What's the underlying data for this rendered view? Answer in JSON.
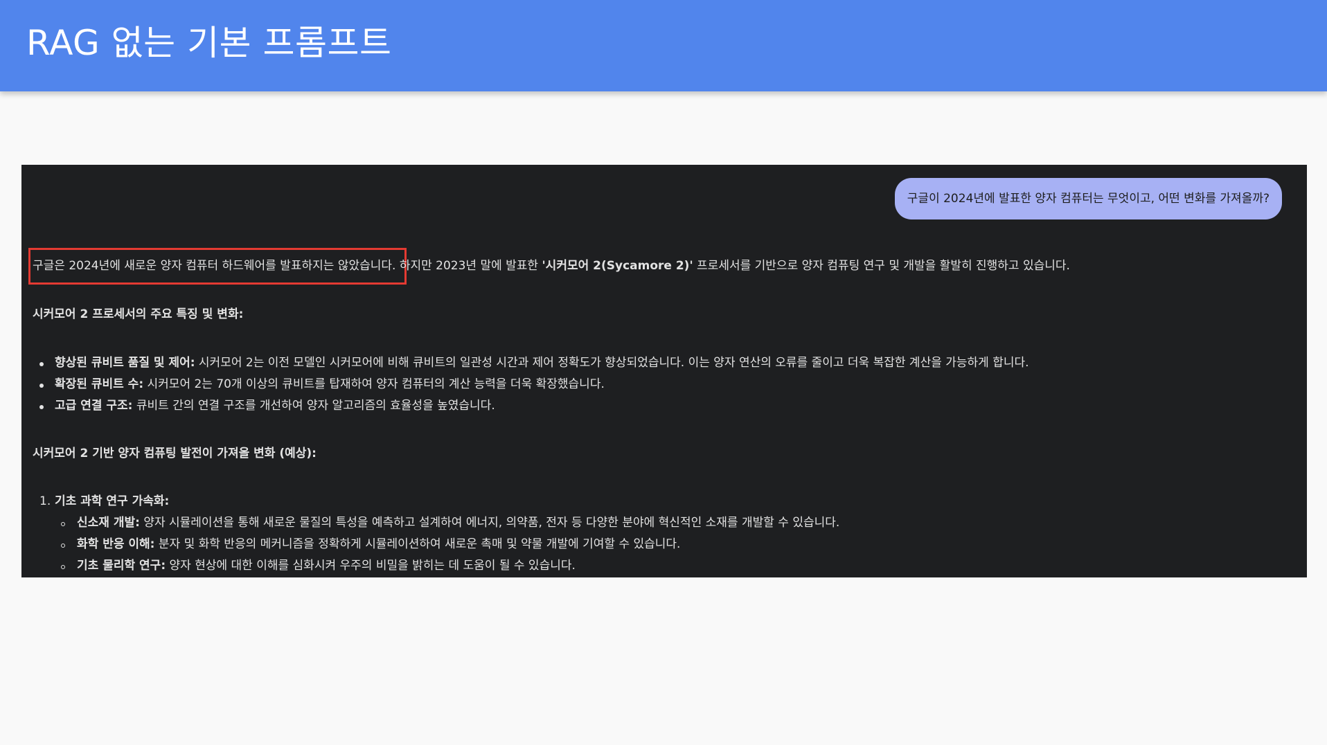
{
  "header": {
    "title": "RAG 없는 기본 프롬프트"
  },
  "colors": {
    "header_bg": "#5185ec",
    "panel_bg": "#1e1f21",
    "bubble_bg": "#a7b1f4",
    "highlight_border": "#e43a32"
  },
  "chat": {
    "user_query": "구글이 2024년에 발표한 양자 컴퓨터는 무엇이고, 어떤 변화를 가져올까?",
    "answer": {
      "intro_highlight": "구글은 2024년에 새로운 양자 컴퓨터 하드웨어를 발표하지는 않았습니다.",
      "intro_rest_1": "하지만 2023년 말에 발표한 ",
      "intro_bold": "'시커모어 2(Sycamore 2)'",
      "intro_rest_2": " 프로세서를 기반으로 양자 컴퓨팅 연구 및 개발을 활발히 진행하고 있습니다.",
      "section1_heading": "시커모어 2 프로세서의 주요 특징 및 변화:",
      "section1_bullets": [
        {
          "label": "향상된 큐비트 품질 및 제어:",
          "text": " 시커모어 2는 이전 모델인 시커모어에 비해 큐비트의 일관성 시간과 제어 정확도가 향상되었습니다. 이는 양자 연산의 오류를 줄이고 더욱 복잡한 계산을 가능하게 합니다."
        },
        {
          "label": "확장된 큐비트 수:",
          "text": " 시커모어 2는 70개 이상의 큐비트를 탑재하여 양자 컴퓨터의 계산 능력을 더욱 확장했습니다."
        },
        {
          "label": "고급 연결 구조:",
          "text": " 큐비트 간의 연결 구조를 개선하여 양자 알고리즘의 효율성을 높였습니다."
        }
      ],
      "section2_heading": "시커모어 2 기반 양자 컴퓨팅 발전이 가져올 변화 (예상):",
      "section2_items": [
        {
          "number": "1.",
          "title": "기초 과학 연구 가속화:",
          "subitems": [
            {
              "label": "신소재 개발:",
              "text": " 양자 시뮬레이션을 통해 새로운 물질의 특성을 예측하고 설계하여 에너지, 의약품, 전자 등 다양한 분야에 혁신적인 소재를 개발할 수 있습니다."
            },
            {
              "label": "화학 반응 이해:",
              "text": " 분자 및 화학 반응의 메커니즘을 정확하게 시뮬레이션하여 새로운 촉매 및 약물 개발에 기여할 수 있습니다."
            },
            {
              "label": "기초 물리학 연구:",
              "text": " 양자 현상에 대한 이해를 심화시켜 우주의 비밀을 밝히는 데 도움이 될 수 있습니다."
            }
          ]
        }
      ]
    }
  }
}
